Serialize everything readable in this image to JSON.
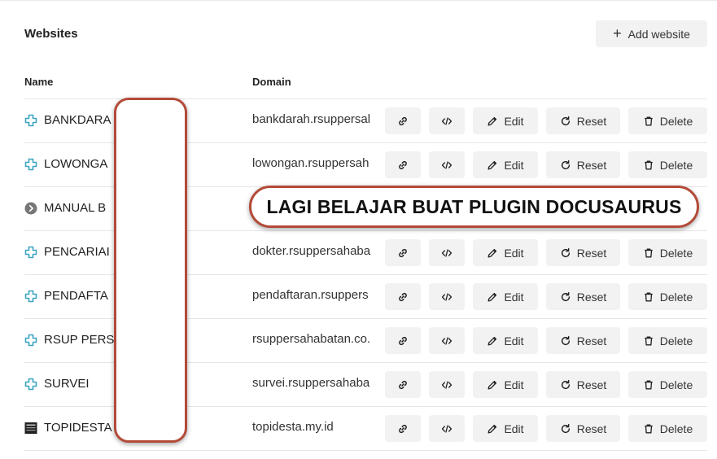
{
  "header": {
    "title": "Websites",
    "add_button_label": "Add website"
  },
  "table": {
    "columns": {
      "name": "Name",
      "domain": "Domain"
    },
    "action_labels": {
      "edit": "Edit",
      "reset": "Reset",
      "delete": "Delete"
    },
    "rows": [
      {
        "name": "BANKDARA",
        "domain": "bankdarah.rsuppersal",
        "icon": "puzzle-plus-icon",
        "show_actions": true
      },
      {
        "name": "LOWONGA",
        "domain": "lowongan.rsuppersah",
        "icon": "puzzle-plus-icon",
        "show_actions": true
      },
      {
        "name": "MANUAL B",
        "domain": "",
        "icon": "gray-chevron-circle-icon",
        "show_actions": false
      },
      {
        "name": "PENCARIAI",
        "domain": "dokter.rsuppersahaba",
        "icon": "puzzle-plus-icon",
        "show_actions": true
      },
      {
        "name": "PENDAFTA",
        "domain": "pendaftaran.rsuppers",
        "icon": "puzzle-plus-icon",
        "show_actions": true
      },
      {
        "name": "RSUP PERS",
        "domain": "rsuppersahabatan.co.",
        "icon": "puzzle-plus-icon",
        "show_actions": true
      },
      {
        "name": "SURVEI",
        "domain": "survei.rsuppersahaba",
        "icon": "puzzle-plus-icon",
        "show_actions": true
      },
      {
        "name": "TOPIDESTA",
        "domain": "topidesta.my.id",
        "icon": "dark-thumbnail-icon",
        "show_actions": true
      }
    ]
  },
  "overlay": {
    "banner_text": "LAGI BELAJAR BUAT PLUGIN DOCUSAURUS"
  },
  "colors": {
    "accent_icon": "#3aa4c0",
    "overlay_border": "#b34a38",
    "button_bg": "#f2f2f2"
  }
}
